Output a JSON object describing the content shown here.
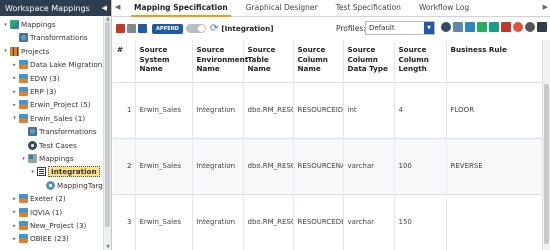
{
  "left_panel": {
    "title": "Workspace Mappings",
    "tree": [
      {
        "label": "Mappings",
        "icon": "root",
        "level": 0,
        "toggle": "▾"
      },
      {
        "label": "Transformations",
        "icon": "trans",
        "level": 1,
        "toggle": ""
      },
      {
        "label": "Projects",
        "icon": "projects",
        "level": 0,
        "toggle": "▾"
      },
      {
        "label": "Data Lake Migration (3)",
        "icon": "proj",
        "level": 1,
        "toggle": "▸"
      },
      {
        "label": "EDW (3)",
        "icon": "proj",
        "level": 1,
        "toggle": "▸"
      },
      {
        "label": "ERP (3)",
        "icon": "proj",
        "level": 1,
        "toggle": "▸"
      },
      {
        "label": "Erwin_Project (5)",
        "icon": "proj",
        "level": 1,
        "toggle": "▸"
      },
      {
        "label": "Erwin_Sales (1)",
        "icon": "proj",
        "level": 1,
        "toggle": "▾"
      },
      {
        "label": "Transformations",
        "icon": "trans",
        "level": 2,
        "toggle": ""
      },
      {
        "label": "Test Cases",
        "icon": "tests",
        "level": 2,
        "toggle": ""
      },
      {
        "label": "Mappings",
        "icon": "maps",
        "level": 2,
        "toggle": "▾"
      },
      {
        "label": "Integration",
        "icon": "integ",
        "level": 3,
        "toggle": "▾",
        "selected": true
      },
      {
        "label": "MappingTargets",
        "icon": "target",
        "level": 4,
        "toggle": ""
      },
      {
        "label": "Exeter (2)",
        "icon": "proj",
        "level": 1,
        "toggle": "▸"
      },
      {
        "label": "IQVIA (1)",
        "icon": "proj",
        "level": 1,
        "toggle": "▸"
      },
      {
        "label": "New_Project (3)",
        "icon": "proj",
        "level": 1,
        "toggle": "▸"
      },
      {
        "label": "OBIEE (23)",
        "icon": "proj",
        "level": 1,
        "toggle": "▸"
      }
    ]
  },
  "tabs": [
    {
      "label": "Mapping Specification",
      "active": true
    },
    {
      "label": "Graphical Designer",
      "active": false
    },
    {
      "label": "Test Specification",
      "active": false
    },
    {
      "label": "Workflow Log",
      "active": false
    }
  ],
  "toolbar": {
    "append_label": "APPEND",
    "breadcrumb": "[Integration]",
    "profiles_label": "Profiles:",
    "profiles_value": "Default"
  },
  "grid": {
    "columns": [
      "#",
      "Source System Name",
      "Source Environment Name",
      "Source Table Name",
      "Source Column Name",
      "Source Column Data Type",
      "Source Column Length",
      "Business Rule"
    ],
    "rows": [
      [
        "1",
        "Erwin_Sales",
        "Integration",
        "dbo.RM_RESOURCE",
        "RESOURCEID",
        "int",
        "4",
        "FLOOR"
      ],
      [
        "2",
        "Erwin_Sales",
        "Integration",
        "dbo.RM_RESOURCE",
        "RESOURCENAME",
        "varchar",
        "100",
        "REVERSE"
      ],
      [
        "3",
        "Erwin_Sales",
        "Integration",
        "dbo.RM_RESOURCE",
        "RESOURCEDESC",
        "varchar",
        "150",
        ""
      ]
    ]
  }
}
